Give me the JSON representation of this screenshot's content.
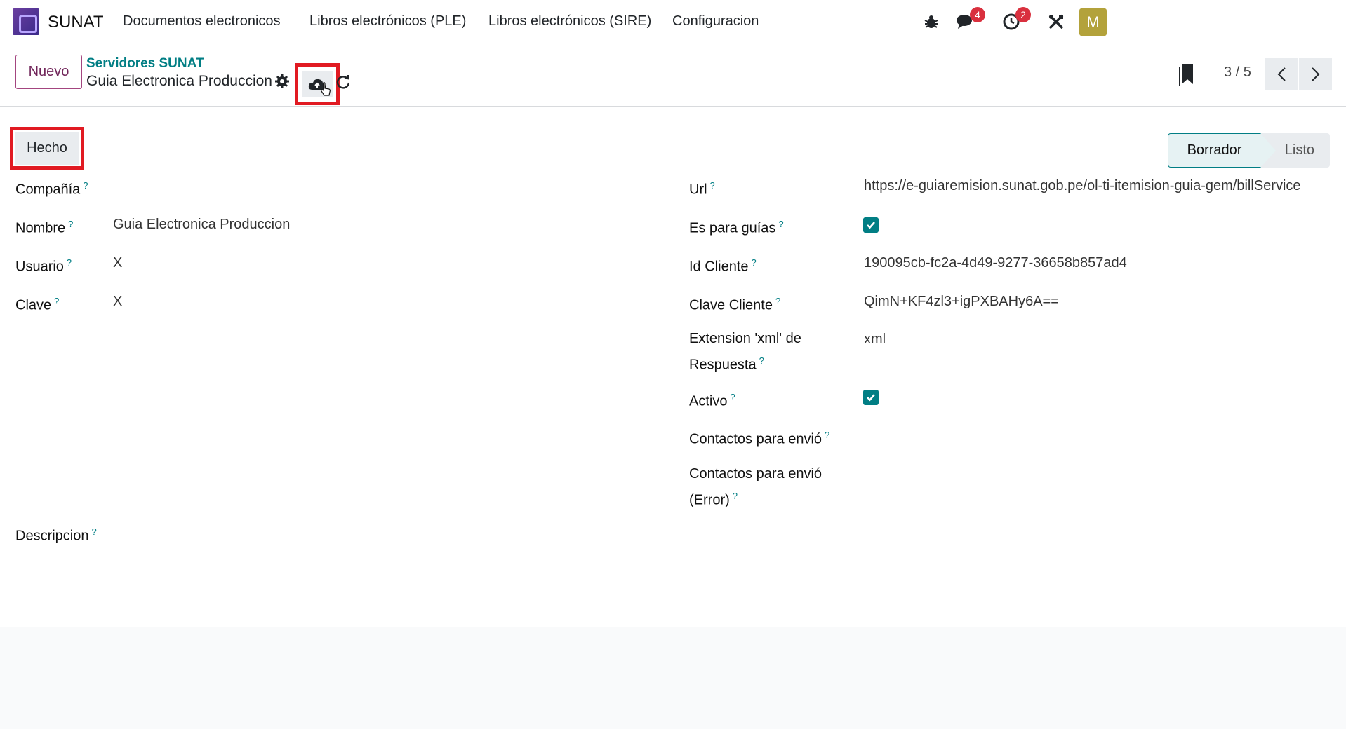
{
  "navbar": {
    "app_name": "SUNAT",
    "menu": [
      "Documentos electronicos",
      "Libros electrónicos (PLE)",
      "Libros electrónicos (SIRE)",
      "Configuracion"
    ],
    "messages_count": "4",
    "activities_count": "2",
    "avatar_letter": "M"
  },
  "control_panel": {
    "new_label": "Nuevo",
    "breadcrumb_parent": "Servidores SUNAT",
    "breadcrumb_current": "Guia Electronica Produccion",
    "pager": "3 / 5"
  },
  "form": {
    "done_label": "Hecho",
    "status": [
      "Borrador",
      "Listo"
    ],
    "help_mark": "?",
    "left": [
      {
        "label": "Compañía",
        "value": ""
      },
      {
        "label": "Nombre",
        "value": "Guia Electronica Produccion"
      },
      {
        "label": "Usuario",
        "value": "X"
      },
      {
        "label": "Clave",
        "value": "X"
      }
    ],
    "description_label": "Descripcion",
    "right": {
      "url": {
        "label": "Url",
        "value": "https://e-guiaremision.sunat.gob.pe/ol-ti-itemision-guia-gem/billService"
      },
      "for_guides": {
        "label": "Es para guías",
        "checked": true
      },
      "client_id": {
        "label": "Id Cliente",
        "value": "190095cb-fc2a-4d49-9277-36658b857ad4"
      },
      "client_key": {
        "label": "Clave Cliente",
        "value": "QimN+KF4zl3+igPXBAHy6A=="
      },
      "xml_ext": {
        "label_line1": "Extension 'xml' de",
        "label_line2": "Respuesta",
        "value": "xml"
      },
      "active": {
        "label": "Activo",
        "checked": true
      },
      "contacts": {
        "label": "Contactos para envió"
      },
      "contacts_error": {
        "label_line1": "Contactos para envió",
        "label_line2": "(Error)"
      }
    }
  },
  "colors": {
    "accent": "#017e84",
    "brand": "#71255a",
    "highlight": "#e11a22"
  }
}
